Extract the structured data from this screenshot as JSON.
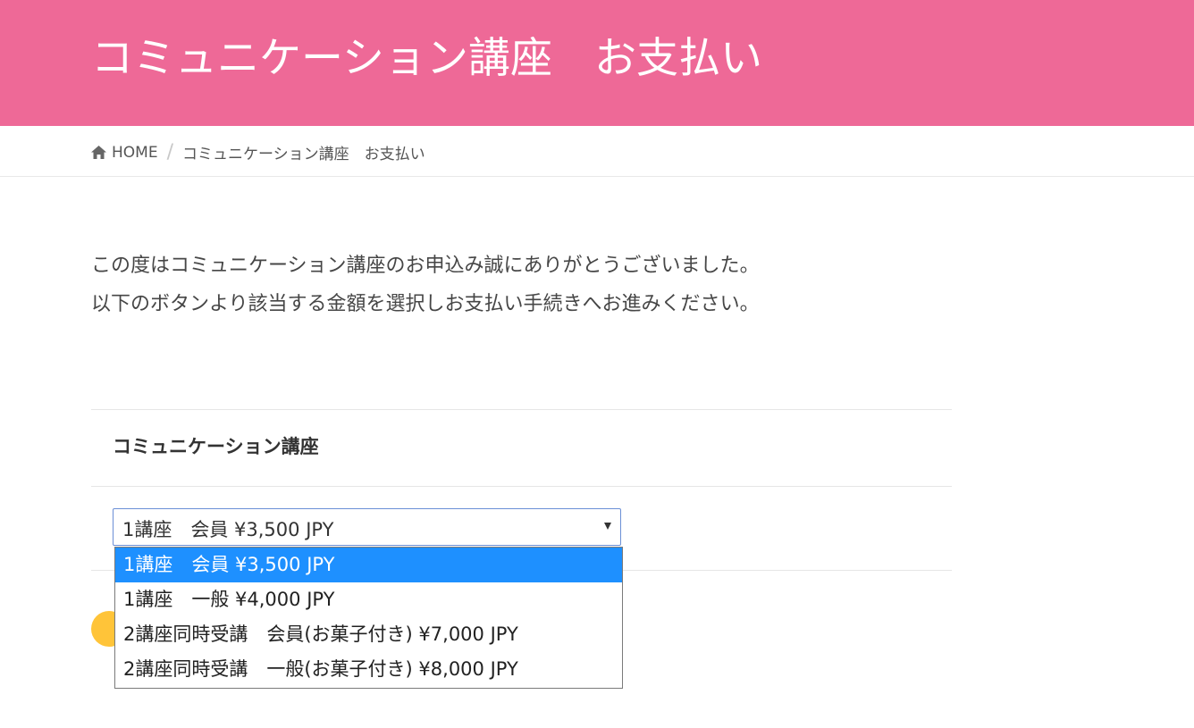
{
  "header": {
    "title": "コミュニケーション講座　お支払い"
  },
  "breadcrumb": {
    "home": "HOME",
    "separator": "/",
    "current": "コミュニケーション講座　お支払い"
  },
  "intro": {
    "line1": "この度はコミュニケーション講座のお申込み誠にありがとうございました。",
    "line2": "以下のボタンより該当する金額を選択しお支払い手続きへお進みください。"
  },
  "section": {
    "title": "コミュニケーション講座"
  },
  "select": {
    "value": "1講座　会員 ¥3,500 JPY",
    "options": [
      "1講座　会員 ¥3,500 JPY",
      "1講座　一般 ¥4,000 JPY",
      "2講座同時受講　会員(お菓子付き) ¥7,000 JPY",
      "2講座同時受講　一般(お菓子付き) ¥8,000 JPY"
    ],
    "selected_index": 0
  },
  "colors": {
    "header_bg": "#ee6997",
    "option_highlight": "#1e90ff",
    "paypal_button": "#ffc439"
  },
  "icons": {
    "home": "home-icon",
    "dropdown_arrow": "chevron-down-icon"
  }
}
